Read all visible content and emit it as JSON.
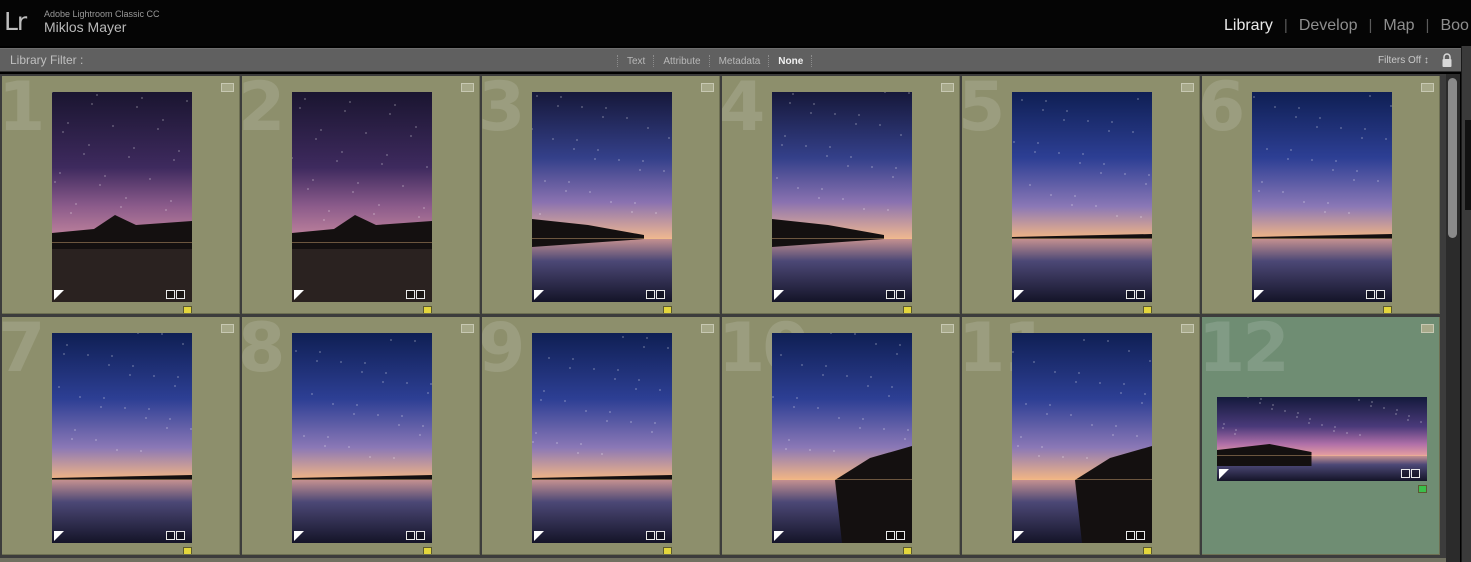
{
  "app": {
    "logo": "Lr",
    "product": "Adobe Lightroom Classic CC",
    "user": "Miklos Mayer"
  },
  "modules": [
    {
      "label": "Library",
      "active": true
    },
    {
      "label": "Develop",
      "active": false
    },
    {
      "label": "Map",
      "active": false
    },
    {
      "label": "Boo",
      "active": false
    }
  ],
  "filter_bar": {
    "label": "Library Filter :",
    "options": [
      {
        "label": "Text",
        "active": false
      },
      {
        "label": "Attribute",
        "active": false
      },
      {
        "label": "Metadata",
        "active": false
      },
      {
        "label": "None",
        "active": true
      }
    ],
    "preset": "Filters Off ↕"
  },
  "colors": {
    "cell_bg": "#8d8f6c",
    "cell_selected_bg": "#6f8d73",
    "label_yellow": "#e3d63c",
    "label_green": "#3bbf4a"
  },
  "grid": {
    "cells": [
      {
        "index": "1",
        "orientation": "portrait",
        "scene": "trees",
        "label": "yellow",
        "selected": false
      },
      {
        "index": "2",
        "orientation": "portrait",
        "scene": "trees",
        "label": "yellow",
        "selected": false
      },
      {
        "index": "3",
        "orientation": "portrait",
        "scene": "shore",
        "label": "yellow",
        "selected": false
      },
      {
        "index": "4",
        "orientation": "portrait",
        "scene": "shore",
        "label": "yellow",
        "selected": false
      },
      {
        "index": "5",
        "orientation": "portrait",
        "scene": "lake",
        "label": "yellow",
        "selected": false
      },
      {
        "index": "6",
        "orientation": "portrait",
        "scene": "lake",
        "label": "yellow",
        "selected": false
      },
      {
        "index": "7",
        "orientation": "portrait",
        "scene": "lake",
        "label": "yellow",
        "selected": false
      },
      {
        "index": "8",
        "orientation": "portrait",
        "scene": "lake",
        "label": "yellow",
        "selected": false
      },
      {
        "index": "9",
        "orientation": "portrait",
        "scene": "lake",
        "label": "yellow",
        "selected": false
      },
      {
        "index": "10",
        "orientation": "portrait",
        "scene": "shore-right",
        "label": "yellow",
        "selected": false
      },
      {
        "index": "11",
        "orientation": "portrait",
        "scene": "shore-right",
        "label": "yellow",
        "selected": false
      },
      {
        "index": "12",
        "orientation": "landscape",
        "scene": "panorama",
        "label": "green",
        "selected": true
      }
    ]
  }
}
